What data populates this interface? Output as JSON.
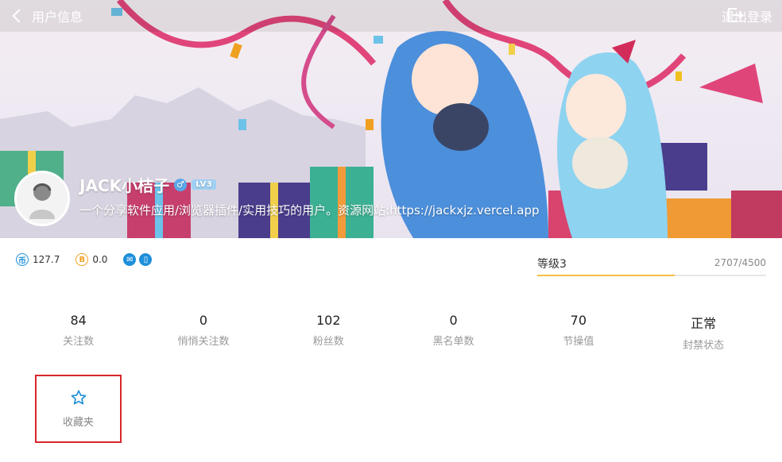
{
  "header": {
    "back_label": "用户信息",
    "logout_label": "退出登录"
  },
  "profile": {
    "username": "JACK小桔子",
    "gender_symbol": "♂",
    "level_badge": "LV3",
    "bio": "一个分享软件应用/浏览器插件/实用技巧的用户。资源网站:https://jackxjz.vercel.app"
  },
  "wallet": {
    "coin_value": "127.7",
    "bcoin_value": "0.0"
  },
  "level": {
    "name": "等级3",
    "exp_text": "2707/4500",
    "progress_fraction": 0.6016
  },
  "counts": [
    {
      "value": "84",
      "label": "关注数"
    },
    {
      "value": "0",
      "label": "悄悄关注数"
    },
    {
      "value": "102",
      "label": "粉丝数"
    },
    {
      "value": "0",
      "label": "黑名单数"
    },
    {
      "value": "70",
      "label": "节操值"
    },
    {
      "value": "正常",
      "label": "封禁状态"
    }
  ],
  "favorites": {
    "label": "收藏夹"
  },
  "colors": {
    "accent_blue": "#1e8fd9",
    "gold": "#f0a020",
    "level_bar": "#f5c043",
    "highlight_border": "#d9262c"
  }
}
